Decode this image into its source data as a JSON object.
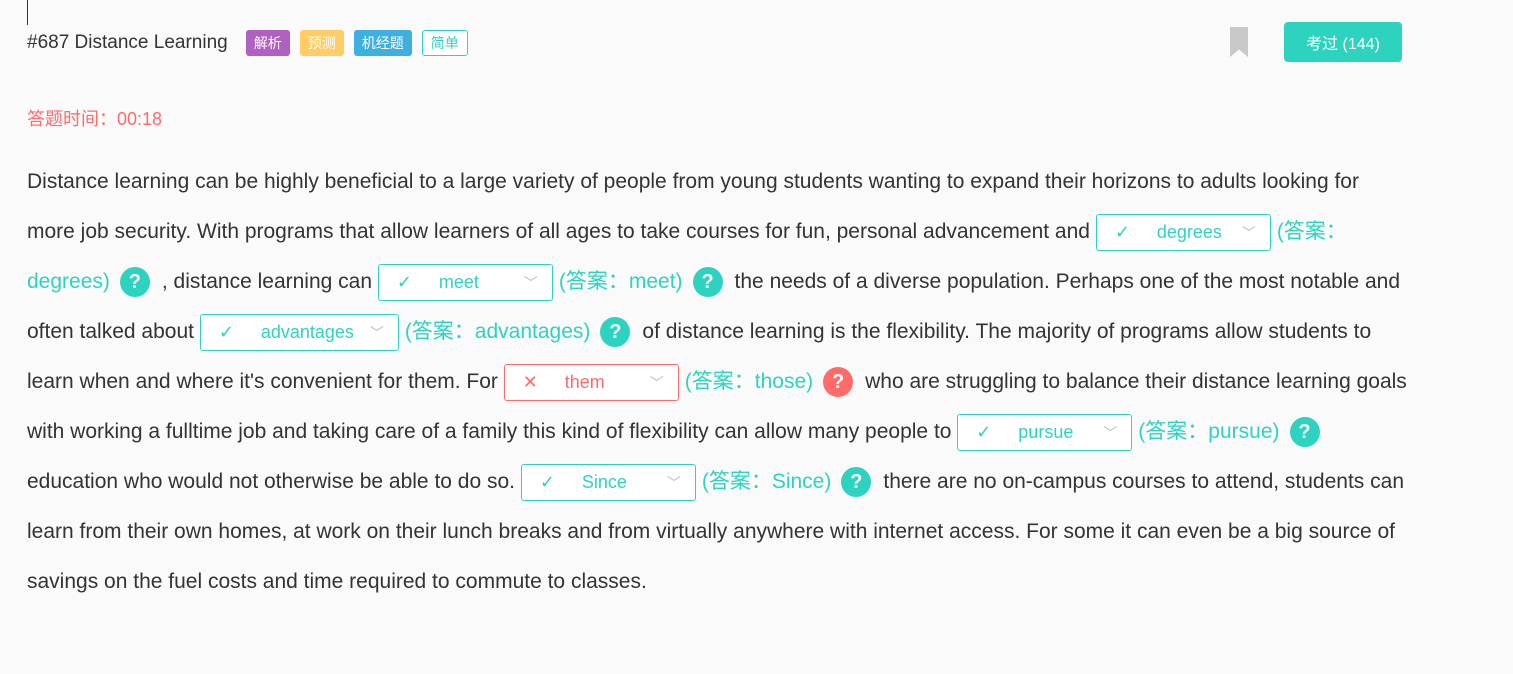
{
  "header": {
    "title": "#687 Distance Learning",
    "tags": [
      {
        "label": "解析",
        "color": "#b060c0"
      },
      {
        "label": "预测",
        "color": "#ffcc66"
      },
      {
        "label": "机经题",
        "color": "#3eb0e0"
      },
      {
        "label": "简单",
        "color": "#2ed3bf"
      }
    ],
    "pass_button": "考过 (144)"
  },
  "timer": "答题时间：00:18",
  "passage": [
    {
      "type": "text",
      "text": "Distance learning can be highly beneficial to a large variety of people from young students wanting to expand their horizons to adults looking for more job security. With programs that allow learners of all ages to take courses for fun, personal advancement and "
    },
    {
      "type": "blank",
      "value": "degrees",
      "answer": "(答案：degrees)",
      "correct": true,
      "width": 175
    },
    {
      "type": "text",
      "text": ", distance learning can "
    },
    {
      "type": "blank",
      "value": "meet",
      "answer": "(答案：meet)",
      "correct": true,
      "width": 175
    },
    {
      "type": "text",
      "text": "the needs of a diverse population. Perhaps one of the most notable and often talked about "
    },
    {
      "type": "blank",
      "value": "advantages",
      "answer": "(答案：advantages)",
      "correct": true,
      "width": 199
    },
    {
      "type": "text",
      "text": "of distance learning is the flexibility. The majority of programs allow students to learn when and where it's convenient for them. For "
    },
    {
      "type": "blank",
      "value": "them",
      "answer": "(答案：those)",
      "correct": false,
      "width": 175
    },
    {
      "type": "text",
      "text": "who are struggling to balance their distance learning goals with working a fulltime job and taking care of a family this kind of flexibility can allow many people to "
    },
    {
      "type": "blank",
      "value": "pursue",
      "answer": "(答案：pursue)",
      "correct": true,
      "width": 175
    },
    {
      "type": "text",
      "text": "education who would not otherwise be able to do so. "
    },
    {
      "type": "blank",
      "value": "Since",
      "answer": "(答案：Since)",
      "correct": true,
      "width": 175
    },
    {
      "type": "text",
      "text": "there are no on-campus courses to attend, students can learn from their own homes, at work on their lunch breaks and from virtually anywhere with internet access. For some it can even be a big source of savings on the fuel costs and time required to commute to classes."
    }
  ]
}
